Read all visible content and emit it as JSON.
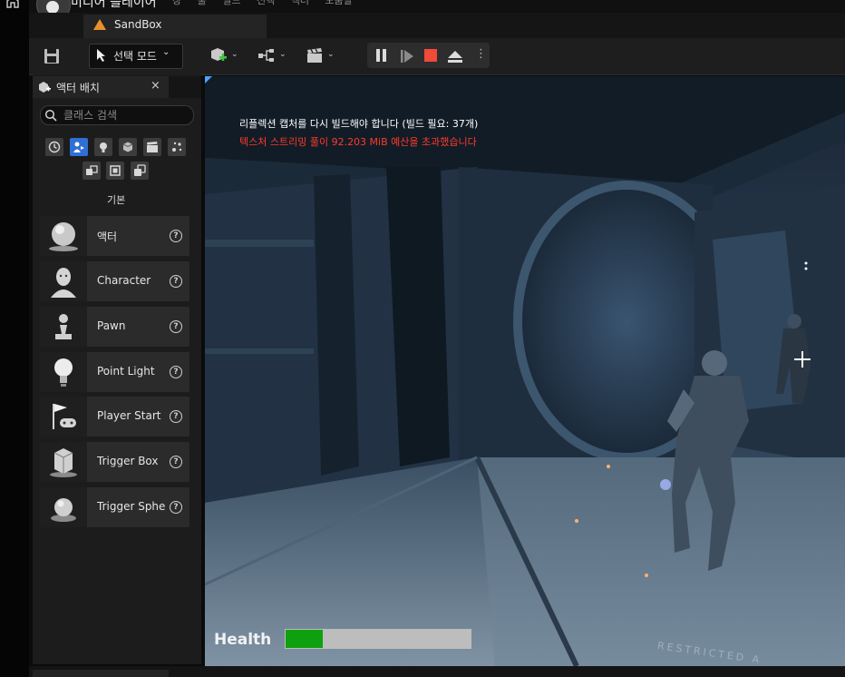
{
  "window": {
    "app_title": "미디어 플레이어",
    "menu_ghost": "창 툴 빌드 선택 액터 도움말"
  },
  "tab": {
    "label": "SandBox"
  },
  "toolbar": {
    "mode_label": "선택 모드",
    "mode_chevron": "⌄",
    "more": "⋮"
  },
  "panel": {
    "title": "액터 배치",
    "close": "×",
    "search_placeholder": "클래스 검색",
    "section_label": "기본",
    "categories": [
      {
        "icon": "recent-clock-icon",
        "active": false
      },
      {
        "icon": "basic-actors-icon",
        "active": true
      },
      {
        "icon": "lights-icon",
        "active": false
      },
      {
        "icon": "shapes-icon",
        "active": false
      },
      {
        "icon": "cinematic-icon",
        "active": false
      },
      {
        "icon": "visual-effects-icon",
        "active": false
      },
      {
        "icon": "volumes-icon",
        "active": false
      },
      {
        "icon": "geometry-icon",
        "active": false
      },
      {
        "icon": "all-classes-icon",
        "active": false
      }
    ],
    "items": [
      {
        "label": "액터",
        "icon": "actor-sphere-icon"
      },
      {
        "label": "Character",
        "icon": "character-icon"
      },
      {
        "label": "Pawn",
        "icon": "pawn-icon"
      },
      {
        "label": "Point Light",
        "icon": "point-light-icon"
      },
      {
        "label": "Player Start",
        "icon": "player-start-icon"
      },
      {
        "label": "Trigger Box",
        "icon": "trigger-box-icon"
      },
      {
        "label": "Trigger Spher",
        "icon": "trigger-sphere-icon"
      }
    ],
    "help_glyph": "?"
  },
  "viewport": {
    "message_1": "리플렉션 캡처를 다시 빌드해야 합니다 (빌드 필요: 37개)",
    "message_2": "텍스처 스트리밍 풀이 92.203 MiB 예산을 초과했습니다",
    "message_2_color": "#ff3a2a",
    "health_label": "Health",
    "health_fraction": 0.2,
    "health_color": "#0fa00f",
    "floor_text": "RESTRICTED A"
  }
}
